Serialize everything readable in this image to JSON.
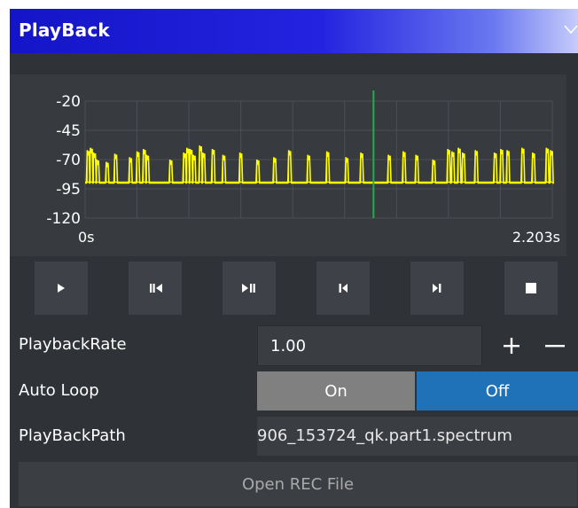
{
  "panel": {
    "title": "PlayBack",
    "collapse_icon": "chevron-down-icon"
  },
  "chart": {
    "y_ticks": [
      "-20",
      "-45",
      "-70",
      "-95",
      "-120"
    ],
    "x_start_label": "0s",
    "x_end_label": "2.203s",
    "colors": {
      "signal": "#ffff00",
      "cursor": "#1fae4c",
      "grid": "#4c4f55",
      "background": "#373a3f"
    }
  },
  "chart_data": {
    "type": "line",
    "xlabel": "",
    "ylabel": "",
    "xlim": [
      0,
      2.203
    ],
    "ylim": [
      -120,
      -20
    ],
    "y_ticks": [
      -20,
      -45,
      -70,
      -95,
      -120
    ],
    "x_tick_labels": [
      "0s",
      "2.203s"
    ],
    "grid": true,
    "cursor_x": 1.36,
    "baseline": -90,
    "bursts": [
      {
        "x": 0.01,
        "peak": -62
      },
      {
        "x": 0.025,
        "peak": -60
      },
      {
        "x": 0.04,
        "peak": -64
      },
      {
        "x": 0.055,
        "peak": -70
      },
      {
        "x": 0.1,
        "peak": -72
      },
      {
        "x": 0.14,
        "peak": -65
      },
      {
        "x": 0.21,
        "peak": -68
      },
      {
        "x": 0.245,
        "peak": -63
      },
      {
        "x": 0.275,
        "peak": -61
      },
      {
        "x": 0.29,
        "peak": -66
      },
      {
        "x": 0.4,
        "peak": -70
      },
      {
        "x": 0.465,
        "peak": -64
      },
      {
        "x": 0.48,
        "peak": -60
      },
      {
        "x": 0.495,
        "peak": -61
      },
      {
        "x": 0.51,
        "peak": -66
      },
      {
        "x": 0.54,
        "peak": -58
      },
      {
        "x": 0.555,
        "peak": -64
      },
      {
        "x": 0.6,
        "peak": -61
      },
      {
        "x": 0.65,
        "peak": -66
      },
      {
        "x": 0.73,
        "peak": -64
      },
      {
        "x": 0.81,
        "peak": -70
      },
      {
        "x": 0.89,
        "peak": -68
      },
      {
        "x": 0.96,
        "peak": -62
      },
      {
        "x": 1.05,
        "peak": -66
      },
      {
        "x": 1.14,
        "peak": -63
      },
      {
        "x": 1.23,
        "peak": -68
      },
      {
        "x": 1.3,
        "peak": -64
      },
      {
        "x": 1.43,
        "peak": -66
      },
      {
        "x": 1.5,
        "peak": -63
      },
      {
        "x": 1.56,
        "peak": -66
      },
      {
        "x": 1.64,
        "peak": -70
      },
      {
        "x": 1.71,
        "peak": -61
      },
      {
        "x": 1.73,
        "peak": -63
      },
      {
        "x": 1.76,
        "peak": -60
      },
      {
        "x": 1.78,
        "peak": -64
      },
      {
        "x": 1.84,
        "peak": -62
      },
      {
        "x": 1.93,
        "peak": -64
      },
      {
        "x": 1.96,
        "peak": -61
      },
      {
        "x": 1.99,
        "peak": -62
      },
      {
        "x": 2.06,
        "peak": -60
      },
      {
        "x": 2.11,
        "peak": -64
      },
      {
        "x": 2.175,
        "peak": -60
      },
      {
        "x": 2.195,
        "peak": -62
      }
    ]
  },
  "controls": {
    "play_icon": "play-icon",
    "prev_frame_icon": "step-back-icon",
    "play_pause_icon": "play-pause-icon",
    "skip_start_icon": "skip-start-icon",
    "skip_end_icon": "skip-end-icon",
    "stop_icon": "stop-icon"
  },
  "playback_rate": {
    "label": "PlaybackRate",
    "value": "1.00",
    "increment_icon": "plus-icon",
    "decrement_icon": "minus-icon"
  },
  "auto_loop": {
    "label": "Auto Loop",
    "on_label": "On",
    "off_label": "Off",
    "selected": "Off"
  },
  "playback_path": {
    "label": "PlayBackPath",
    "value": "906_153724_qk.part1.spectrum"
  },
  "open_button": {
    "label": "Open REC File"
  }
}
